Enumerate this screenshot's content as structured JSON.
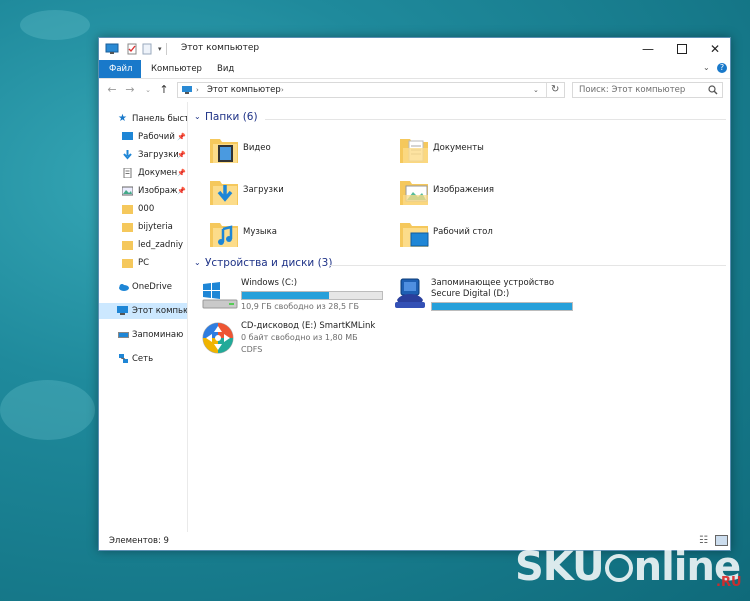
{
  "window": {
    "title": "Этот компьютер"
  },
  "ribbon": {
    "tabs": [
      "Файл",
      "Компьютер",
      "Вид"
    ],
    "help": "?"
  },
  "address": {
    "path": "Этот компьютер",
    "search_placeholder": "Поиск: Этот компьютер"
  },
  "nav": {
    "quick_access": "Панель быст",
    "items": [
      {
        "label": "Рабочий",
        "icon": "desktop-icon",
        "pinned": true
      },
      {
        "label": "Загрузки",
        "icon": "download-icon",
        "pinned": true
      },
      {
        "label": "Докумен",
        "icon": "document-icon",
        "pinned": true
      },
      {
        "label": "Изображ",
        "icon": "picture-icon",
        "pinned": true
      },
      {
        "label": "000",
        "icon": "folder-icon"
      },
      {
        "label": "bijyteria",
        "icon": "folder-icon"
      },
      {
        "label": "led_zadniy",
        "icon": "folder-icon"
      },
      {
        "label": "PC",
        "icon": "folder-icon"
      }
    ],
    "onedrive": "OneDrive",
    "this_pc": "Этот компью",
    "storage": "Запоминаю",
    "network": "Сеть"
  },
  "folders_section": {
    "title": "Папки (6)"
  },
  "folders": [
    {
      "label": "Видео",
      "icon": "video-folder-icon"
    },
    {
      "label": "Документы",
      "icon": "documents-folder-icon"
    },
    {
      "label": "Загрузки",
      "icon": "downloads-folder-icon"
    },
    {
      "label": "Изображения",
      "icon": "pictures-folder-icon"
    },
    {
      "label": "Музыка",
      "icon": "music-folder-icon"
    },
    {
      "label": "Рабочий стол",
      "icon": "desktop-folder-icon"
    }
  ],
  "devices_section": {
    "title": "Устройства и диски (3)"
  },
  "drives": [
    {
      "name": "Windows (C:)",
      "info": "10,9 ГБ свободно из 28,5 ГБ",
      "used_fraction": 0.62,
      "icon": "windows-drive-icon"
    },
    {
      "name": "Запоминающее устройство",
      "name2": "Secure Digital (D:)",
      "used_fraction": 1.0,
      "icon": "sd-card-icon"
    },
    {
      "name": "CD-дисковод (E:) SmartKMLink",
      "info": "0 байт свободно из 1,80 МБ",
      "fs": "CDFS",
      "icon": "cd-drive-icon"
    }
  ],
  "status": {
    "count": "Элементов: 9"
  },
  "watermark": {
    "text": "SKU",
    "text2": "nline",
    "suffix": ".RU"
  },
  "colors": {
    "accent": "#1979ca",
    "bar": "#26a0da",
    "selection": "#cce8ff"
  }
}
